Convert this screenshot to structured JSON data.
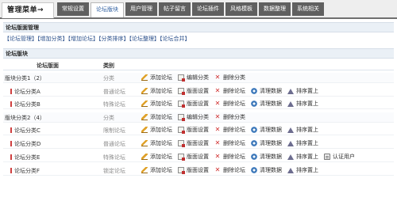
{
  "topbar": {
    "menu_title": "管理菜单→",
    "tabs": [
      {
        "label": "常规设置"
      },
      {
        "label": "论坛版块"
      },
      {
        "label": "用户管理"
      },
      {
        "label": "帖子留言"
      },
      {
        "label": "论坛插件"
      },
      {
        "label": "风格模板"
      },
      {
        "label": "数据整理"
      },
      {
        "label": "系统相关"
      }
    ]
  },
  "manage_section": {
    "title": "论坛版面管理",
    "links": [
      "【论坛管理】",
      "【增加分类】",
      "【增加论坛】",
      "【分类排序】",
      "【论坛整理】",
      "【论坛合并】"
    ]
  },
  "board_section": {
    "title": "论坛版块",
    "col_name": "论坛版面",
    "col_type": "类别"
  },
  "actions": {
    "add_forum": "添加论坛",
    "edit_category": "编辑分类",
    "delete_category": "删除分类",
    "board_settings": "版面设置",
    "delete_forum": "删除论坛",
    "clean_data": "清理数据",
    "move_top": "排序置上",
    "verify_users": "认证用户"
  },
  "rows": [
    {
      "name": "版块分类1（2）",
      "type": "分类"
    },
    {
      "name": "论坛分类A",
      "type": "普通论坛"
    },
    {
      "name": "论坛分类B",
      "type": "特殊论坛"
    },
    {
      "name": "版块分类2（4）",
      "type": "分类"
    },
    {
      "name": "论坛分类C",
      "type": "限制论坛"
    },
    {
      "name": "论坛分类D",
      "type": "普通论坛"
    },
    {
      "name": "论坛分类E",
      "type": "特殊论坛"
    },
    {
      "name": "论坛分类F",
      "type": "锁定论坛"
    }
  ]
}
